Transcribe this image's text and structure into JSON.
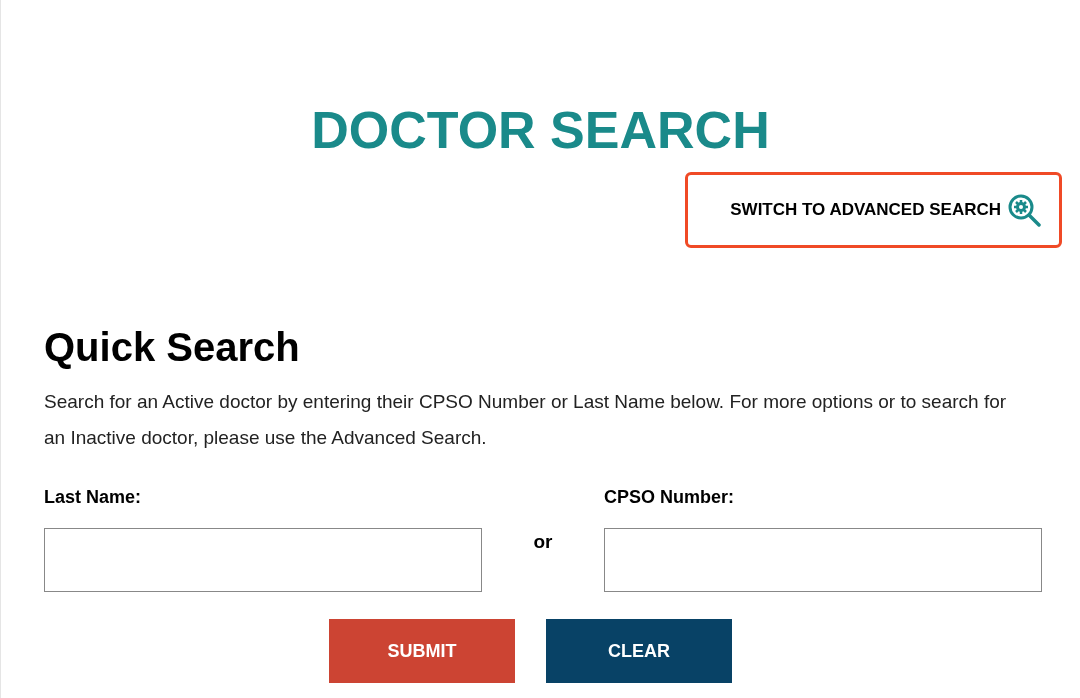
{
  "title": "DOCTOR SEARCH",
  "advanced_search_link": "SWITCH TO ADVANCED SEARCH",
  "quick_search": {
    "heading": "Quick Search",
    "description": "Search for an Active doctor by entering their CPSO Number or Last Name below. For more options or to search for an Inactive doctor, please use the Advanced Search.",
    "fields": [
      {
        "label": "Last Name:"
      },
      {
        "label": "CPSO Number:"
      }
    ],
    "separator": "or",
    "buttons": [
      {
        "label": "SUBMIT",
        "kind": "primary"
      },
      {
        "label": "CLEAR",
        "kind": "secondary"
      }
    ]
  }
}
